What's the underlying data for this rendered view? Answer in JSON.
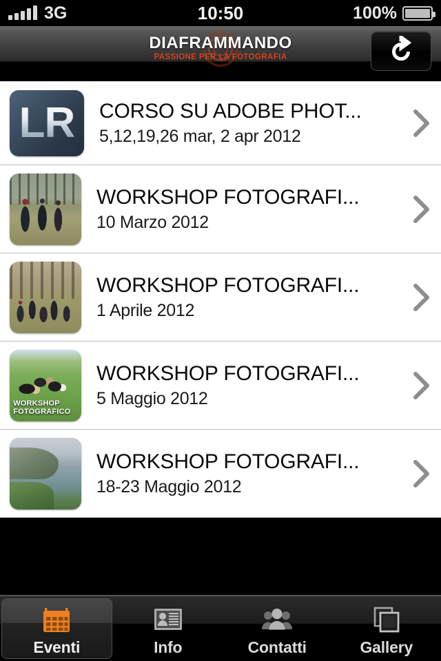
{
  "status_bar": {
    "carrier_network": "3G",
    "time": "10:50",
    "battery_percent": "100%",
    "signal_icon": "signal-bars-icon",
    "battery_icon": "battery-full-icon"
  },
  "nav_bar": {
    "logo_main": "DIAFRAMMANDO",
    "logo_tagline": "PASSIONE PER LA FOTOGRAFIA",
    "refresh_icon": "refresh-icon",
    "logo_accent_color": "#d6411e"
  },
  "events": [
    {
      "title": "CORSO SU ADOBE PHOT...",
      "date": "5,12,19,26 mar, 2 apr 2012",
      "thumb": "adobe-lightroom-icon",
      "thumb_label": "LR",
      "chevron_icon": "chevron-right-icon"
    },
    {
      "title": "WORKSHOP FOTOGRAFI...",
      "date": "10 Marzo 2012",
      "thumb": "photo-people-walking",
      "thumb_label": "",
      "chevron_icon": "chevron-right-icon"
    },
    {
      "title": "WORKSHOP FOTOGRAFI...",
      "date": "1 Aprile 2012",
      "thumb": "photo-group-tripods",
      "thumb_label": "",
      "chevron_icon": "chevron-right-icon"
    },
    {
      "title": "WORKSHOP FOTOGRAFI...",
      "date": "5 Maggio 2012",
      "thumb": "photo-workshop-field",
      "thumb_label": "WORKSHOP FOTOGRAFICO",
      "chevron_icon": "chevron-right-icon"
    },
    {
      "title": "WORKSHOP FOTOGRAFI...",
      "date": "18-23 Maggio 2012",
      "thumb": "photo-coastline",
      "thumb_label": "",
      "chevron_icon": "chevron-right-icon"
    }
  ],
  "tab_bar": {
    "active_index": 0,
    "active_color": "#f08020",
    "items": [
      {
        "label": "Eventi",
        "icon": "calendar-icon"
      },
      {
        "label": "Info",
        "icon": "contact-card-icon"
      },
      {
        "label": "Contatti",
        "icon": "people-group-icon"
      },
      {
        "label": "Gallery",
        "icon": "photos-stack-icon"
      }
    ]
  }
}
